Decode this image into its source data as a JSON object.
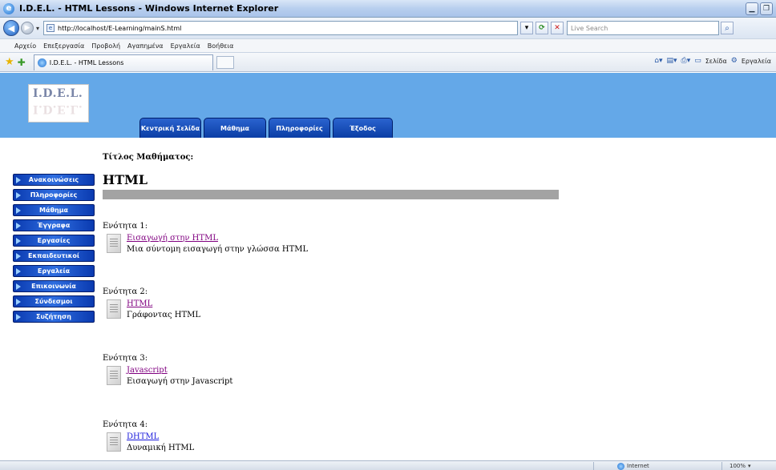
{
  "window": {
    "title": "I.D.E.L. - HTML Lessons - Windows Internet Explorer",
    "icon": "ie-icon"
  },
  "address_bar": {
    "url": "http://localhost/E-Learning/mainS.html",
    "search_placeholder": "Live Search"
  },
  "menu": {
    "items": [
      "Αρχείο",
      "Επεξεργασία",
      "Προβολή",
      "Αγαπημένα",
      "Εργαλεία",
      "Βοήθεια"
    ]
  },
  "tabs": {
    "active_label": "I.D.E.L. - HTML Lessons"
  },
  "command_bar": {
    "page_label": "Σελίδα",
    "tools_label": "Εργαλεία"
  },
  "site": {
    "logo_text": "I.D.E.L.",
    "header_color": "#64a8e8",
    "top_nav": [
      {
        "label": "Κεντρική Σελίδα"
      },
      {
        "label": "Μάθημα"
      },
      {
        "label": "Πληροφορίες"
      },
      {
        "label": "Έξοδος"
      }
    ],
    "side_nav": [
      {
        "label": "Ανακοινώσεις"
      },
      {
        "label": "Πληροφορίες"
      },
      {
        "label": "Μάθημα"
      },
      {
        "label": "Έγγραφα"
      },
      {
        "label": "Εργασίες"
      },
      {
        "label": "Εκπαιδευτικοί"
      },
      {
        "label": "Εργαλεία"
      },
      {
        "label": "Επικοινωνία"
      },
      {
        "label": "Σύνδεσμοι"
      },
      {
        "label": "Συζήτηση"
      }
    ]
  },
  "lesson": {
    "heading": "Τίτλος Μαθήματος:",
    "title": "HTML",
    "units": [
      {
        "label": "Ενότητα 1:",
        "link": "Εισαγωγή στην HTML",
        "description": "Μια σύντομη εισαγωγή στην γλώσσα HTML",
        "visited": true
      },
      {
        "label": "Ενότητα 2:",
        "link": "HTML",
        "description": "Γράφοντας HTML",
        "visited": true
      },
      {
        "label": "Ενότητα 3:",
        "link": "Javascript",
        "description": "Εισαγωγή στην Javascript",
        "visited": true
      },
      {
        "label": "Ενότητα 4:",
        "link": "DHTML",
        "description": "Δυναμική HTML",
        "visited": false
      }
    ]
  },
  "status_bar": {
    "zone": "Internet",
    "zoom": "100%"
  }
}
